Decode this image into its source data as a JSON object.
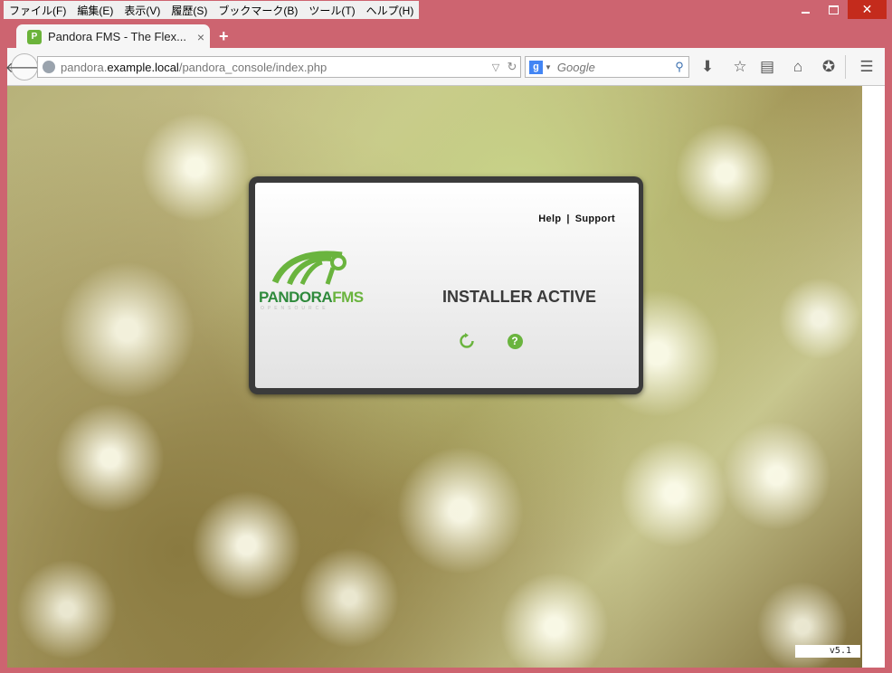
{
  "menu": [
    "ファイル(F)",
    "編集(E)",
    "表示(V)",
    "履歴(S)",
    "ブックマーク(B)",
    "ツール(T)",
    "ヘルプ(H)"
  ],
  "tab": {
    "title": "Pandora FMS - The Flex...",
    "close": "×",
    "new": "+"
  },
  "url": {
    "host_pre": "pandora.",
    "host_main": "example.local",
    "path": "/pandora_console/index.php"
  },
  "search": {
    "placeholder": "Google",
    "engine": "g"
  },
  "login": {
    "help_link": "Help",
    "separator": "|",
    "support_link": "Support",
    "heading": "INSTALLER ACTIVE",
    "logo_main": "PANDORA",
    "logo_fms": "FMS",
    "logo_sub": "OPENSOURCE"
  },
  "version": "v5.1",
  "colors": {
    "accent": "#6ab43e",
    "frame": "#cd6470",
    "close": "#c42b1c"
  }
}
